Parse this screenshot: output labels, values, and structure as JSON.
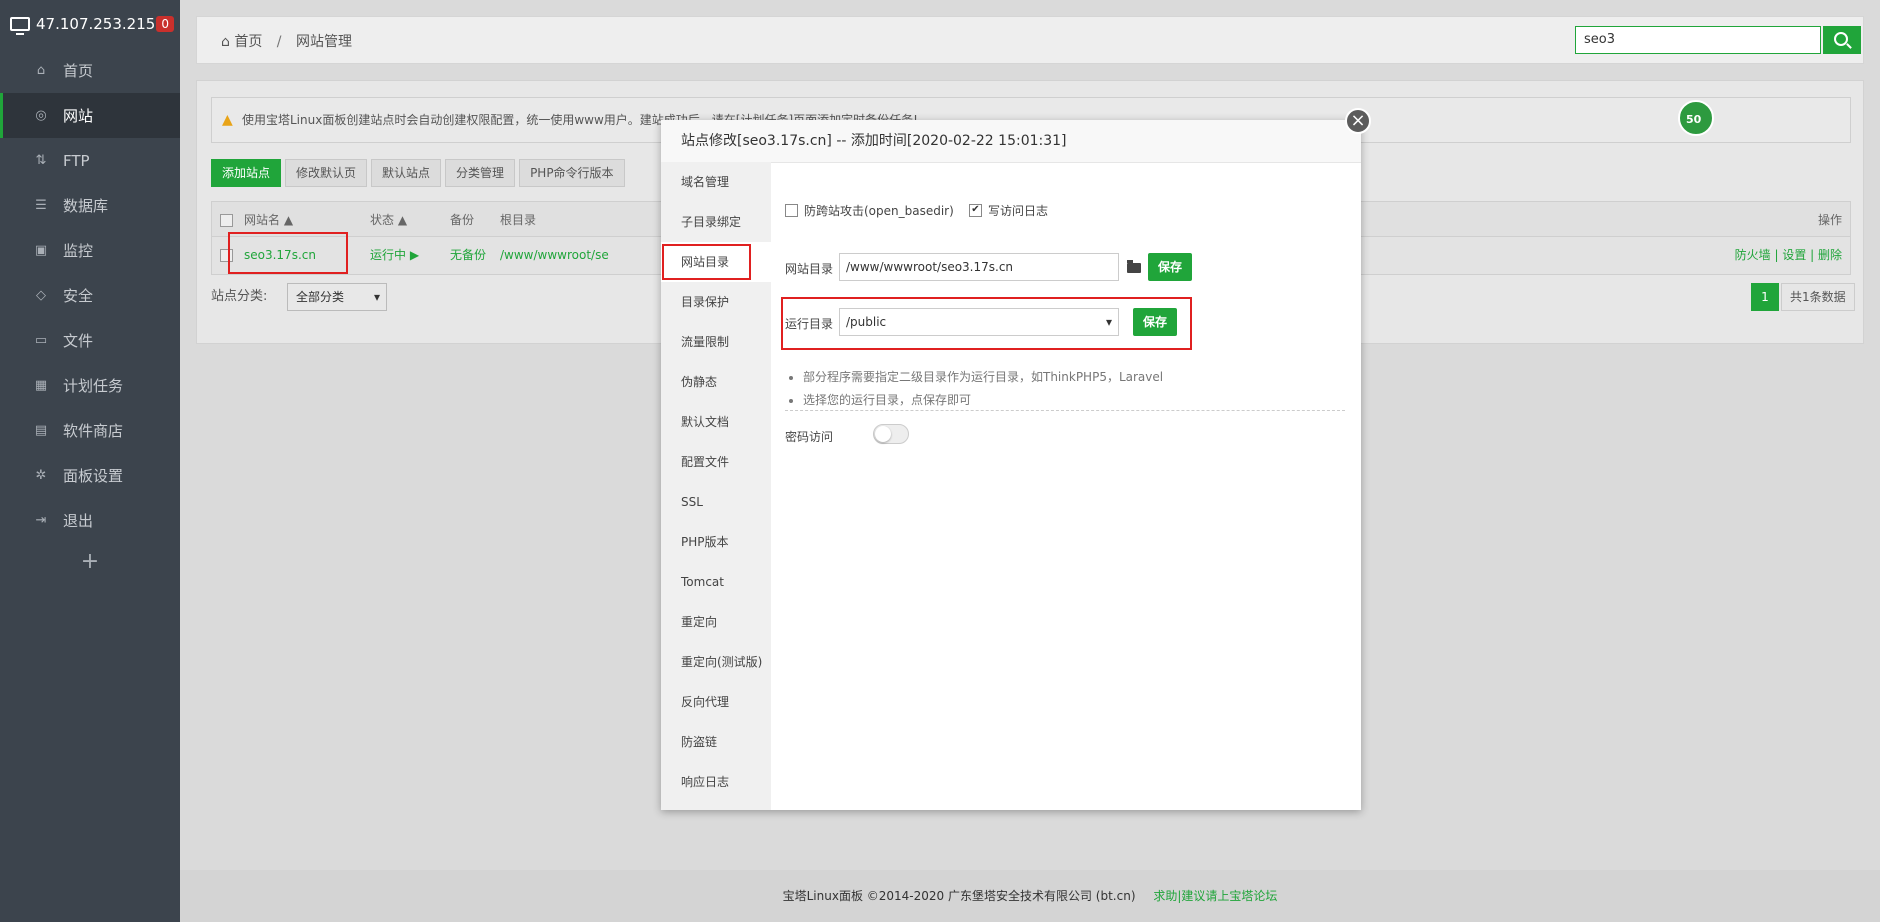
{
  "sidebar": {
    "server_ip": "47.107.253.215",
    "badge": "0",
    "items": [
      {
        "label": "首页",
        "icon": "home-icon",
        "glyph": "⌂"
      },
      {
        "label": "网站",
        "icon": "globe-icon",
        "glyph": "◎"
      },
      {
        "label": "FTP",
        "icon": "ftp-icon",
        "glyph": "⇅"
      },
      {
        "label": "数据库",
        "icon": "database-icon",
        "glyph": "☰"
      },
      {
        "label": "监控",
        "icon": "monitor-icon",
        "glyph": "▣"
      },
      {
        "label": "安全",
        "icon": "shield-icon",
        "glyph": "◇"
      },
      {
        "label": "文件",
        "icon": "folder-icon",
        "glyph": "▭"
      },
      {
        "label": "计划任务",
        "icon": "calendar-icon",
        "glyph": "▦"
      },
      {
        "label": "软件商店",
        "icon": "grid-icon",
        "glyph": "▤"
      },
      {
        "label": "面板设置",
        "icon": "gear-icon",
        "glyph": "✲"
      },
      {
        "label": "退出",
        "icon": "logout-icon",
        "glyph": "⇥"
      }
    ],
    "plus": "+"
  },
  "header": {
    "breadcrumb_home": "首页",
    "breadcrumb_sep": "/",
    "breadcrumb_current": "网站管理",
    "search_value": "seo3"
  },
  "notice": "使用宝塔Linux面板创建站点时会自动创建权限配置，统一使用www用户。建站成功后，请在[计划任务]页面添加定时备份任务!",
  "toolbar": {
    "add_site": "添加站点",
    "edit_default": "修改默认页",
    "default_site": "默认站点",
    "category_mgmt": "分类管理",
    "php_cli": "PHP命令行版本"
  },
  "table": {
    "headers": {
      "name": "网站名",
      "status": "状态",
      "backup": "备份",
      "root": "根目录",
      "ops": "操作"
    },
    "row": {
      "name": "seo3.17s.cn",
      "status": "运行中 ▶",
      "backup": "无备份",
      "root": "/www/wwwroot/se",
      "ops": "防火墙 | 设置 | 删除"
    }
  },
  "classify": {
    "label": "站点分类:",
    "value": "全部分类"
  },
  "pagination": {
    "current": "1",
    "total": "共1条数据"
  },
  "footer": {
    "copyright": "宝塔Linux面板 ©2014-2020 广东堡塔安全技术有限公司 (bt.cn)",
    "link": "求助|建议请上宝塔论坛"
  },
  "edge_badge": "50",
  "modal": {
    "title": "站点修改[seo3.17s.cn] -- 添加时间[2020-02-22 15:01:31]",
    "close": "×",
    "menu": [
      "域名管理",
      "子目录绑定",
      "网站目录",
      "目录保护",
      "流量限制",
      "伪静态",
      "默认文档",
      "配置文件",
      "SSL",
      "PHP版本",
      "Tomcat",
      "重定向",
      "重定向(测试版)",
      "反向代理",
      "防盗链",
      "响应日志"
    ],
    "active_index": 2,
    "anti_xss_label": "防跨站攻击(open_basedir)",
    "anti_xss_checked": false,
    "access_log_label": "写访问日志",
    "access_log_checked": true,
    "site_dir_label": "网站目录",
    "site_dir_value": "/www/wwwroot/seo3.17s.cn",
    "run_dir_label": "运行目录",
    "run_dir_value": "/public",
    "save_label": "保存",
    "tips": [
      "部分程序需要指定二级目录作为运行目录，如ThinkPHP5，Laravel",
      "选择您的运行目录，点保存即可"
    ],
    "password_label": "密码访问",
    "password_enabled": false
  },
  "colors": {
    "accent": "#20a53a",
    "sidebar": "#3c444d",
    "highlight": "#e02020"
  }
}
